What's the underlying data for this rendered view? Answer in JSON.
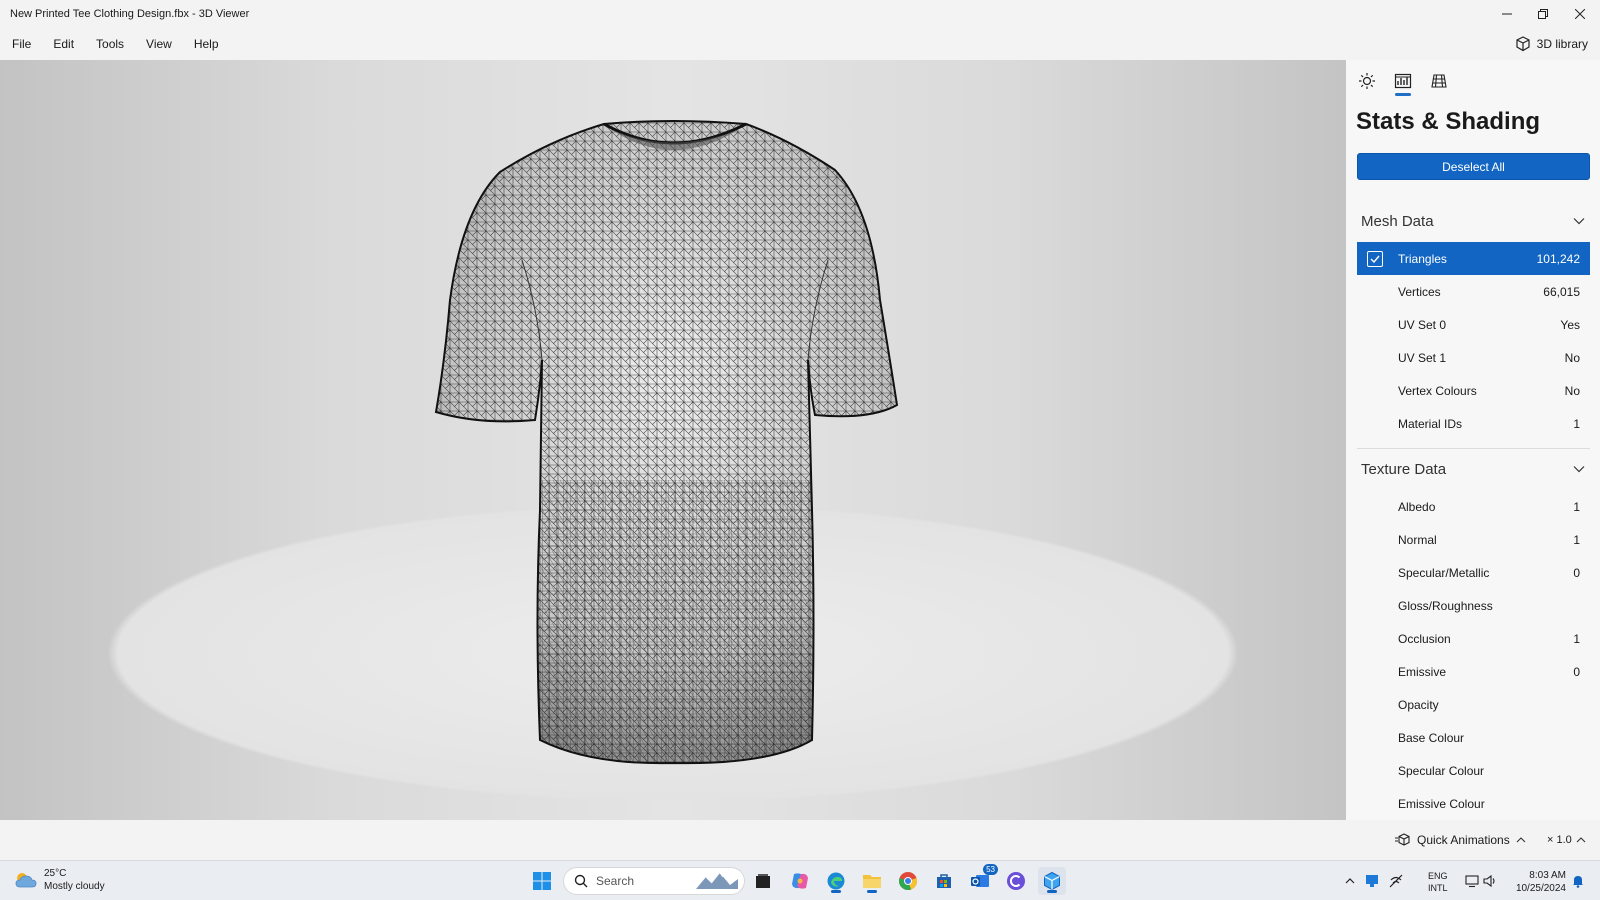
{
  "window": {
    "title": "New Printed Tee Clothing Design.fbx - 3D Viewer",
    "minimize_icon": "minimize-icon",
    "restore_icon": "restore-icon",
    "close_icon": "close-icon"
  },
  "menubar": {
    "items": [
      "File",
      "Edit",
      "Tools",
      "View",
      "Help"
    ],
    "library_label": "3D library"
  },
  "panel": {
    "tabs": [
      "lighting-icon",
      "stats-icon",
      "grid-icon"
    ],
    "active_tab": "stats-icon",
    "title": "Stats & Shading",
    "deselect_label": "Deselect All",
    "mesh_section": "Mesh Data",
    "mesh_rows": [
      {
        "label": "Triangles",
        "value": "101,242",
        "selected": true
      },
      {
        "label": "Vertices",
        "value": "66,015"
      },
      {
        "label": "UV Set 0",
        "value": "Yes"
      },
      {
        "label": "UV Set 1",
        "value": "No"
      },
      {
        "label": "Vertex Colours",
        "value": "No"
      },
      {
        "label": "Material IDs",
        "value": "1"
      }
    ],
    "texture_section": "Texture Data",
    "texture_rows": [
      {
        "label": "Albedo",
        "value": "1"
      },
      {
        "label": "Normal",
        "value": "1"
      },
      {
        "label": "Specular/Metallic",
        "value": "0"
      },
      {
        "label": "Gloss/Roughness",
        "value": ""
      },
      {
        "label": "Occlusion",
        "value": "1"
      },
      {
        "label": "Emissive",
        "value": "0"
      },
      {
        "label": "Opacity",
        "value": ""
      },
      {
        "label": "Base Colour",
        "value": ""
      },
      {
        "label": "Specular Colour",
        "value": ""
      },
      {
        "label": "Emissive Colour",
        "value": ""
      }
    ]
  },
  "statusbar": {
    "quick_animations": "Quick Animations",
    "speed": "× 1.0"
  },
  "taskbar": {
    "weather_temp": "25°C",
    "weather_desc": "Mostly cloudy",
    "search_placeholder": "Search",
    "mail_badge": "53",
    "lang_line1": "ENG",
    "lang_line2": "INTL",
    "time": "8:03 AM",
    "date": "10/25/2024"
  },
  "colors": {
    "accent": "#1265c2",
    "panel_bg": "#f7f7f7",
    "viewport_bg": "#dadada"
  }
}
